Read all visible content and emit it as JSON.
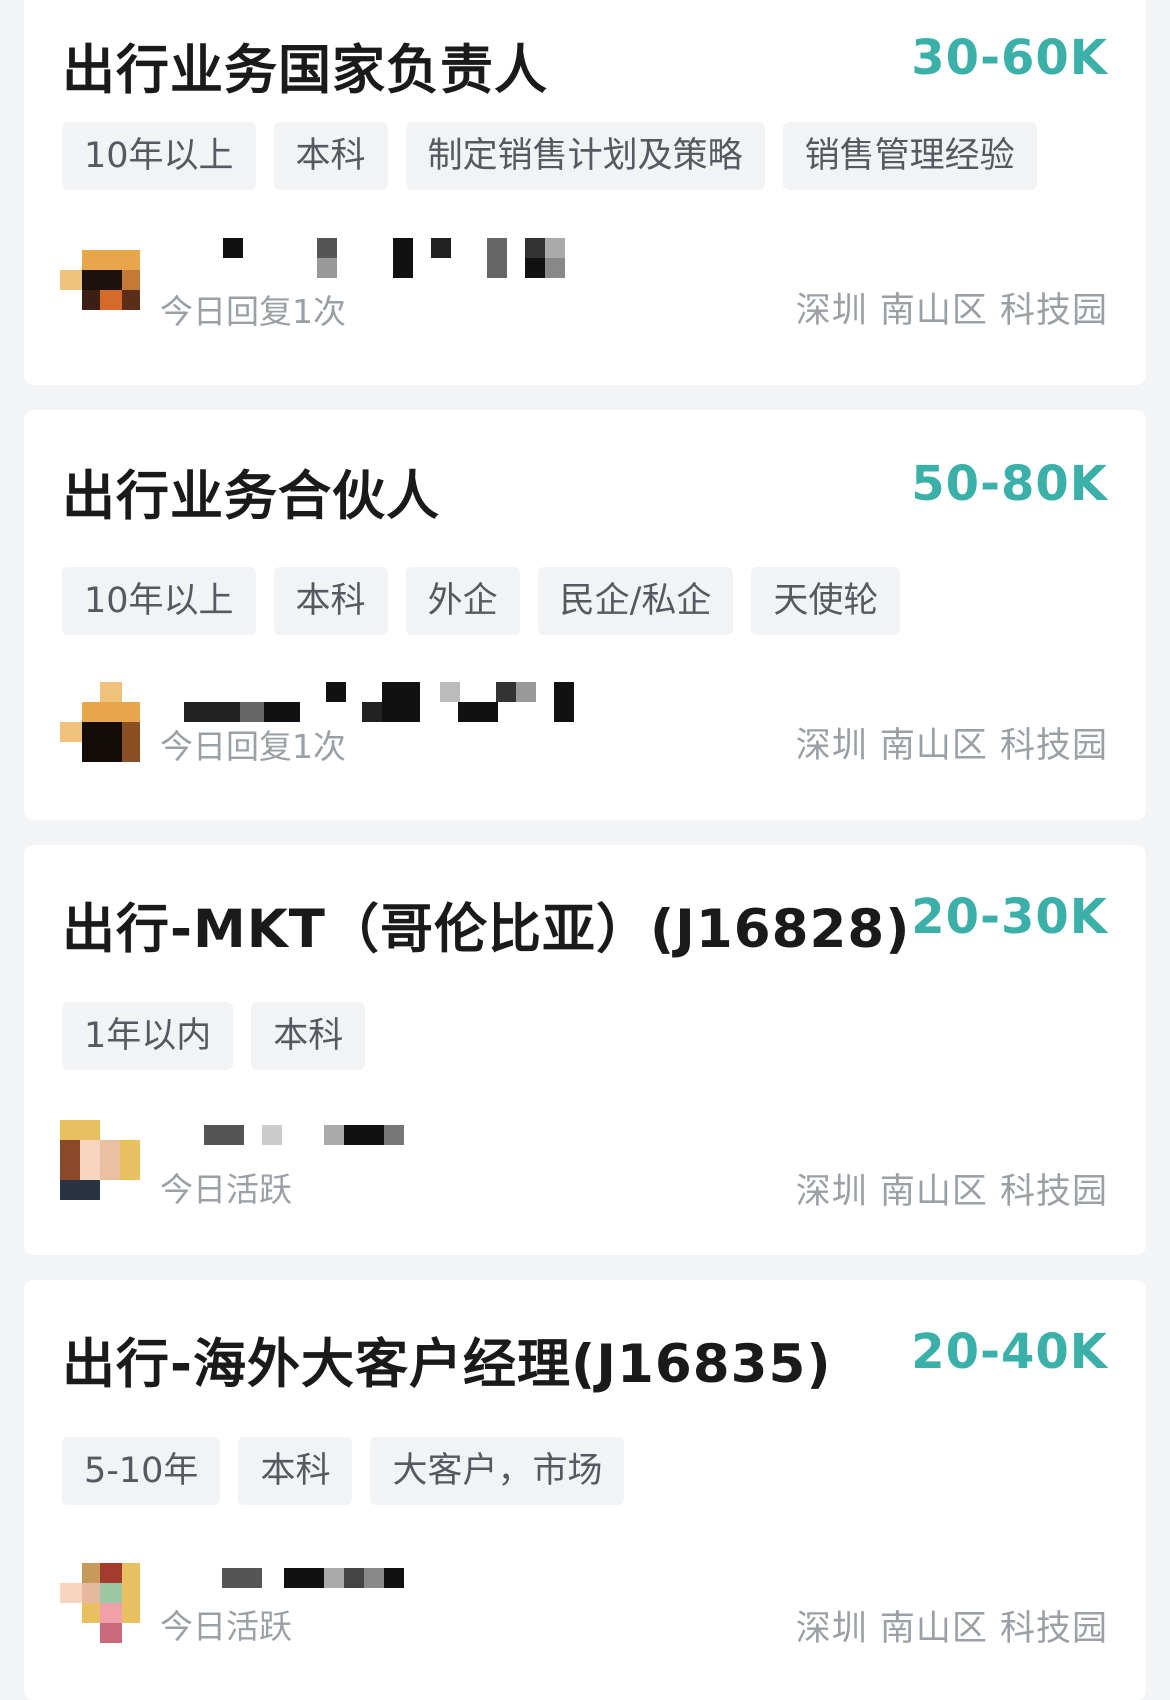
{
  "jobs": [
    {
      "title": "出行业务国家负责人",
      "salary": "30-60K",
      "tags": [
        "10年以上",
        "本科",
        "制定销售计划及策略",
        "销售管理经验"
      ],
      "status": "今日回复1次",
      "location": "深圳 南山区 科技园"
    },
    {
      "title": "出行业务合伙人",
      "salary": "50-80K",
      "tags": [
        "10年以上",
        "本科",
        "外企",
        "民企/私企",
        "天使轮"
      ],
      "status": "今日回复1次",
      "location": "深圳 南山区 科技园"
    },
    {
      "title": "出行-MKT（哥伦比亚）(J16828)",
      "salary": "20-30K",
      "tags": [
        "1年以内",
        "本科"
      ],
      "status": "今日活跃",
      "location": "深圳 南山区 科技园"
    },
    {
      "title": "出行-海外大客户经理(J16835)",
      "salary": "20-40K",
      "tags": [
        "5-10年",
        "本科",
        "大客户，市场"
      ],
      "status": "今日活跃",
      "location": "深圳 南山区 科技园"
    }
  ]
}
